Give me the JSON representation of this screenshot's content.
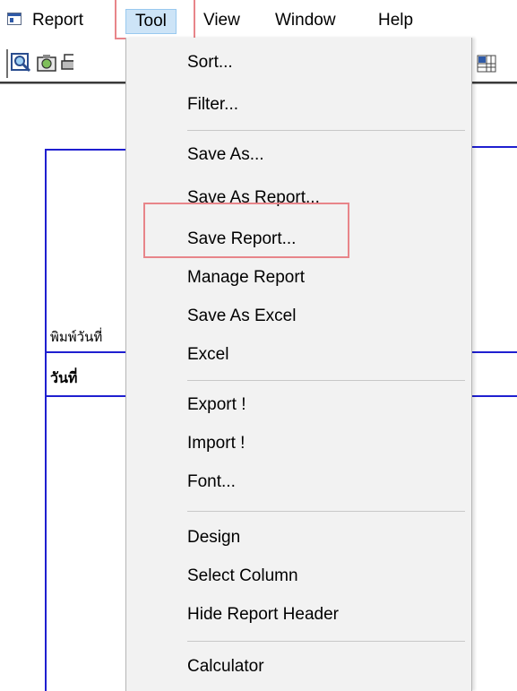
{
  "menubar": {
    "items": [
      "Report",
      "Tool",
      "View",
      "Window",
      "Help"
    ],
    "active": "Tool"
  },
  "toolbar": {
    "icons": [
      "preview-icon",
      "record-icon",
      "print-icon",
      "grid-view-icon"
    ]
  },
  "report": {
    "print_date_label": "พิมพ์วันที่",
    "date_header": "วันที่"
  },
  "tool_menu": {
    "items": [
      "Sort...",
      "Filter...",
      "Save As...",
      "Save As Report...",
      "Save Report...",
      "Manage Report",
      "Save As Excel",
      "Excel",
      "Export !",
      "Import !",
      "Font...",
      "Design",
      "Select Column",
      "Hide Report Header",
      "Calculator"
    ],
    "highlighted": "Save Report..."
  },
  "colors": {
    "menu_active_bg": "#cde4f7",
    "highlight_box": "#e8858a",
    "report_lines": "#1f1fd0",
    "dropdown_bg": "#f2f2f2"
  }
}
